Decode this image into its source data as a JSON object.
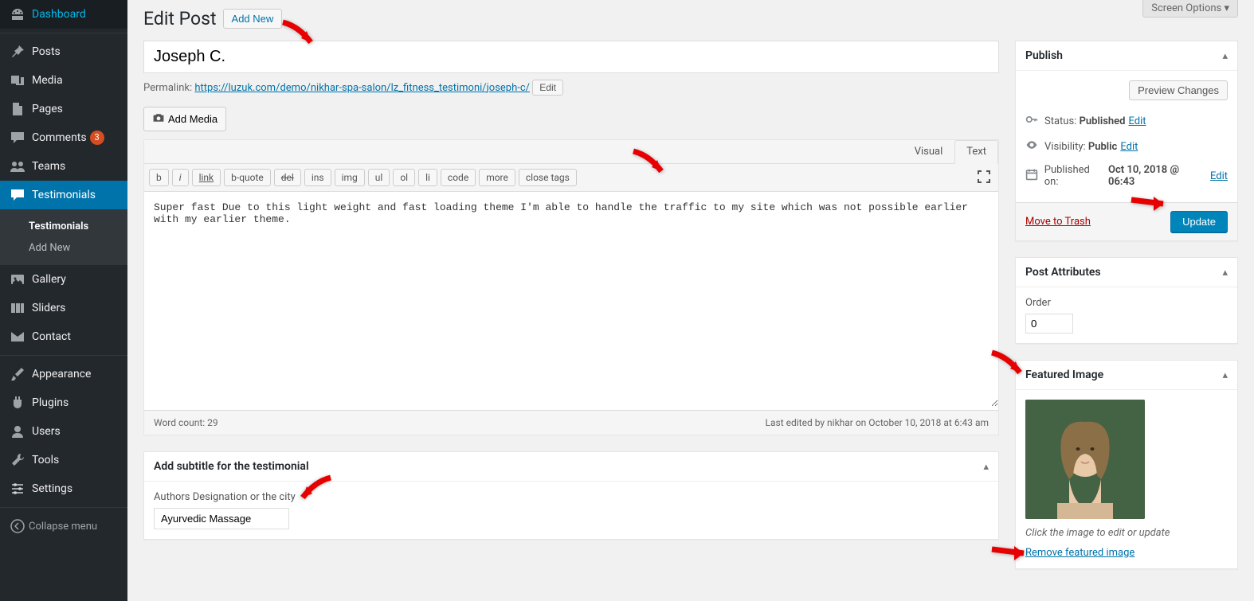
{
  "screen_options": "Screen Options",
  "page_title": "Edit Post",
  "add_new": "Add New",
  "post_title": "Joseph C.",
  "permalink": {
    "label": "Permalink:",
    "base": "https://luzuk.com/demo/nikhar-spa-salon/lz_fitness_testimoni/",
    "slug": "joseph-c/",
    "edit": "Edit"
  },
  "add_media": "Add Media",
  "tabs": {
    "visual": "Visual",
    "text": "Text"
  },
  "toolbar": {
    "b": "b",
    "i": "i",
    "link": "link",
    "bquote": "b-quote",
    "del": "del",
    "ins": "ins",
    "img": "img",
    "ul": "ul",
    "ol": "ol",
    "li": "li",
    "code": "code",
    "more": "more",
    "close": "close tags"
  },
  "editor_content": "Super fast Due to this light weight and fast loading theme I'm able to handle the traffic to my site which was not possible earlier with my earlier theme.",
  "word_count": "Word count: 29",
  "last_edited": "Last edited by nikhar on October 10, 2018 at 6:43 am",
  "subtitle_box": {
    "title": "Add subtitle for the testimonial",
    "label": "Authors Designation or the city",
    "value": "Ayurvedic Massage"
  },
  "publish": {
    "title": "Publish",
    "preview": "Preview Changes",
    "status_label": "Status:",
    "status_value": "Published",
    "visibility_label": "Visibility:",
    "visibility_value": "Public",
    "published_label": "Published on:",
    "published_value": "Oct 10, 2018 @ 06:43",
    "edit": "Edit",
    "trash": "Move to Trash",
    "update": "Update"
  },
  "attributes": {
    "title": "Post Attributes",
    "order_label": "Order",
    "order_value": "0"
  },
  "featured": {
    "title": "Featured Image",
    "caption": "Click the image to edit or update",
    "remove": "Remove featured image"
  },
  "sidebar": {
    "dashboard": "Dashboard",
    "posts": "Posts",
    "media": "Media",
    "pages": "Pages",
    "comments": "Comments",
    "comments_count": "3",
    "teams": "Teams",
    "testimonials": "Testimonials",
    "sub_testimonials": "Testimonials",
    "sub_addnew": "Add New",
    "gallery": "Gallery",
    "sliders": "Sliders",
    "contact": "Contact",
    "appearance": "Appearance",
    "plugins": "Plugins",
    "users": "Users",
    "tools": "Tools",
    "settings": "Settings",
    "collapse": "Collapse menu"
  }
}
